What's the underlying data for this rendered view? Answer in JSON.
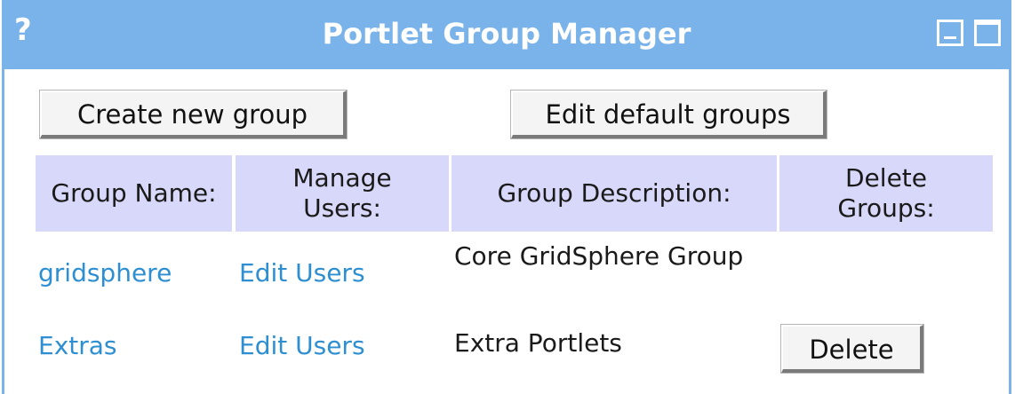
{
  "portlet": {
    "title": "Portlet Group Manager",
    "help_label": "?",
    "controls": [
      "minimize-icon",
      "maximize-icon"
    ]
  },
  "actions": {
    "create_label": "Create new group",
    "edit_defaults_label": "Edit default groups"
  },
  "table": {
    "headers": [
      "Group Name:",
      "Manage Users:",
      "Group Description:",
      "Delete Groups:"
    ],
    "rows": [
      {
        "name": "gridsphere",
        "manage": "Edit Users",
        "description": "Core GridSphere Group",
        "delete": ""
      },
      {
        "name": "Extras",
        "manage": "Edit Users",
        "description": "Extra Portlets",
        "delete": "Delete"
      }
    ]
  },
  "colors": {
    "titlebar": "#7ab3ea",
    "header_bg": "#d8d8fa",
    "link": "#2d8fd2"
  }
}
